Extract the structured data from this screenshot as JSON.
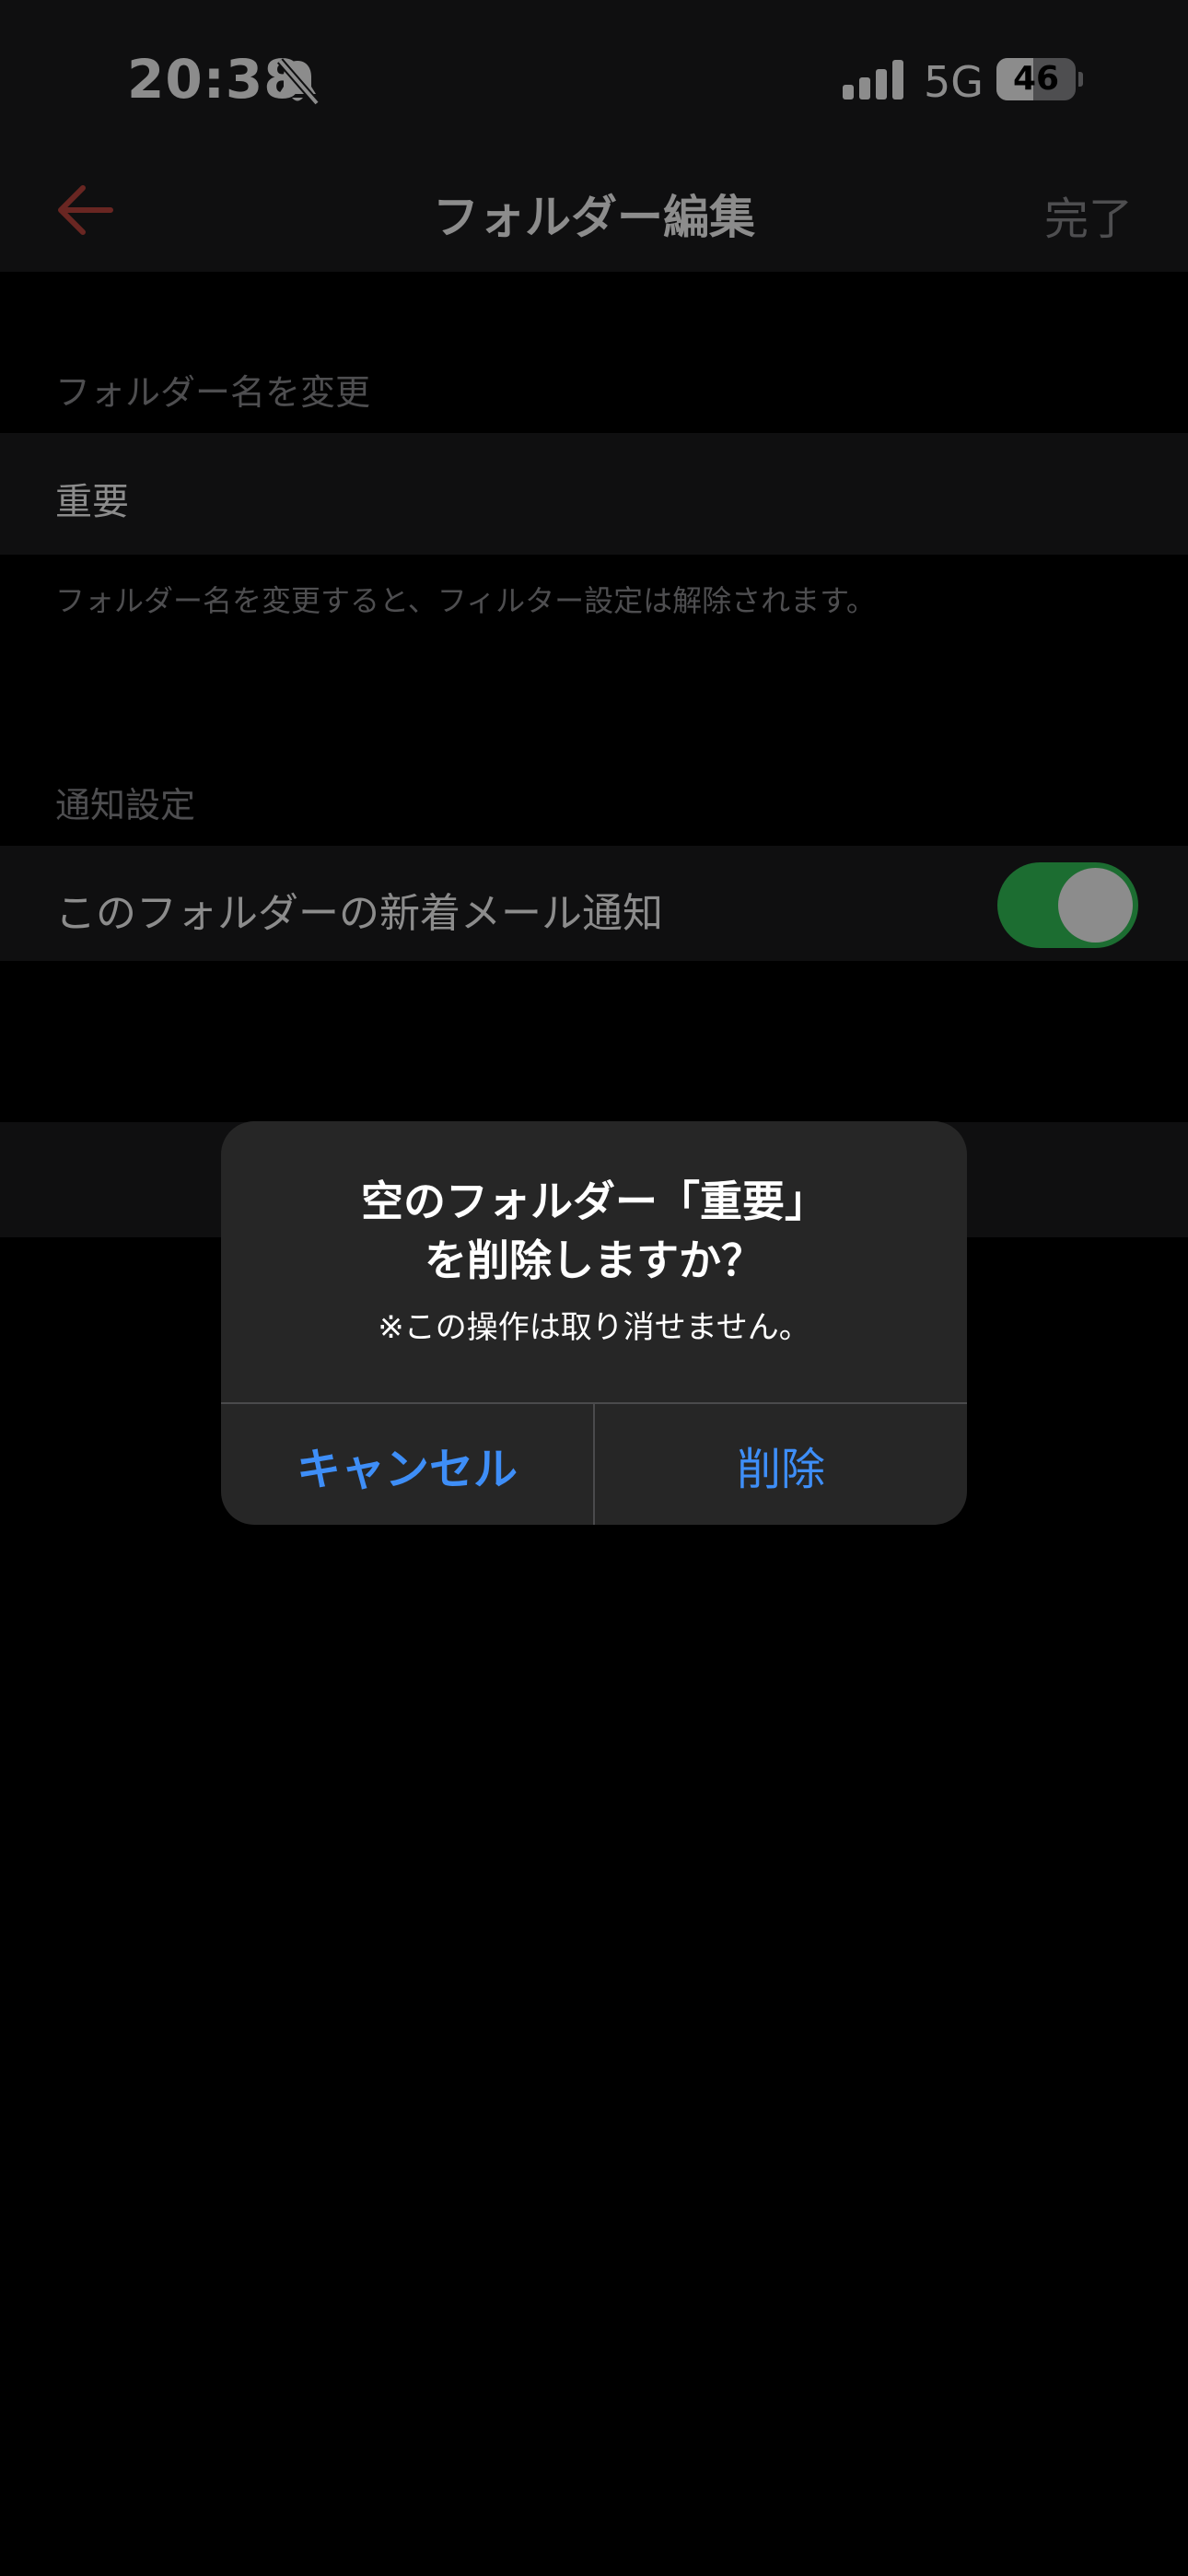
{
  "status_bar": {
    "time": "20:38",
    "network": "5G",
    "battery_level": "46",
    "battery_fraction": 0.46,
    "icons": [
      "bell-slash-icon",
      "signal-icon"
    ]
  },
  "nav": {
    "title": "フォルダー編集",
    "done_label": "完了",
    "back_icon": "arrow-left-icon"
  },
  "rename_section": {
    "header": "フォルダー名を変更",
    "value": "重要",
    "footnote": "フォルダー名を変更すると、フィルター設定は解除されます。"
  },
  "notification_section": {
    "header": "通知設定",
    "label": "このフォルダーの新着メール通知",
    "enabled": true
  },
  "alert": {
    "title_line1": "空のフォルダー「重要」",
    "title_line2": "を削除しますか？",
    "message": "※この操作は取り消せません。",
    "cancel_label": "キャンセル",
    "delete_label": "削除"
  },
  "colors": {
    "accent_red": "#c0453f",
    "alert_button": "#3e8ef7",
    "toggle_on": "#34c759"
  }
}
